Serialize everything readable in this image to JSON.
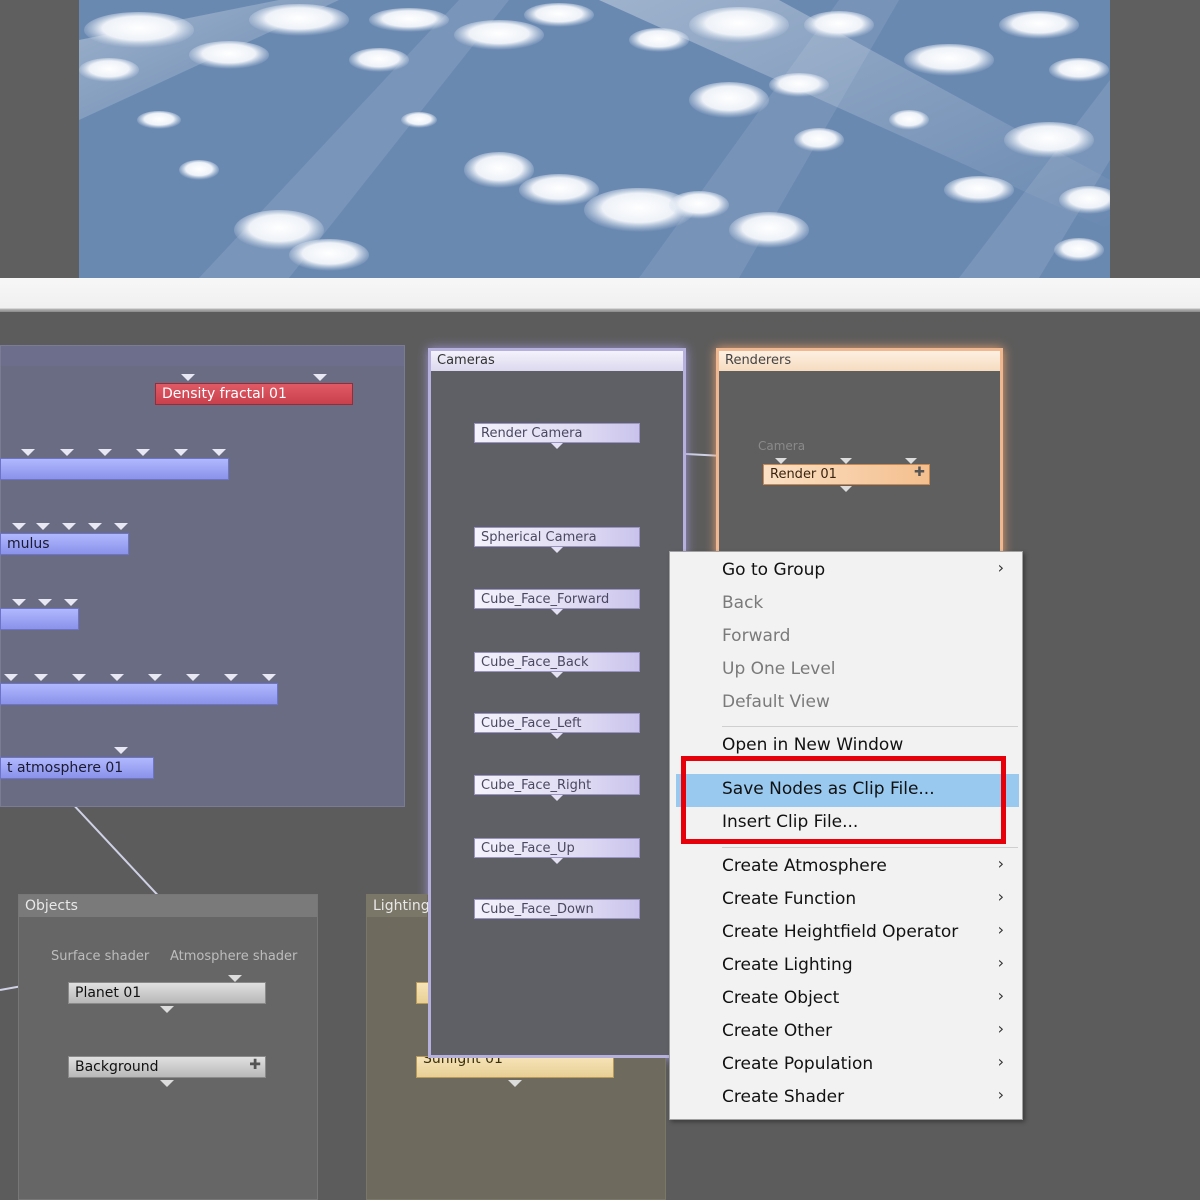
{
  "colors": {
    "menu_highlight": "#99c9ef",
    "annotation_outline": "#e6000a",
    "node_blue": "#9aa2f5",
    "node_red": "#d04c58"
  },
  "groups": {
    "cameras": "Cameras",
    "renderers": "Renderers",
    "objects": "Objects",
    "lighting": "Lighting"
  },
  "nodes": {
    "density_fractal": "Density fractal 01",
    "cumulus": "mulus",
    "atmosphere": "t atmosphere 01",
    "render_camera": "Render Camera",
    "spherical_camera": "Spherical Camera",
    "cube_forward": "Cube_Face_Forward",
    "cube_back": "Cube_Face_Back",
    "cube_left": "Cube_Face_Left",
    "cube_right": "Cube_Face_Right",
    "cube_up": "Cube_Face_Up",
    "cube_down": "Cube_Face_Down",
    "render01": "Render 01",
    "planet01": "Planet 01",
    "background": "Background",
    "sunlight": "Sunlight 01"
  },
  "port_labels": {
    "camera": "Camera",
    "surface_shader": "Surface shader",
    "atmosphere_shader": "Atmosphere shader"
  },
  "menu": {
    "items": [
      {
        "label": "Go to Group",
        "arrow": "›",
        "disabled": false
      },
      {
        "label": "Back",
        "disabled": true
      },
      {
        "label": "Forward",
        "disabled": true
      },
      {
        "label": "Up One Level",
        "disabled": true
      },
      {
        "label": "Default View",
        "disabled": true
      },
      {
        "label": "Open in New Window",
        "disabled": false
      },
      {
        "label": "Save Nodes as Clip File...",
        "disabled": false,
        "highlighted": true
      },
      {
        "label": "Insert Clip File...",
        "disabled": false
      },
      {
        "label": "Create Atmosphere",
        "arrow": "›"
      },
      {
        "label": "Create Function",
        "arrow": "›"
      },
      {
        "label": "Create Heightfield Operator",
        "arrow": "›"
      },
      {
        "label": "Create Lighting",
        "arrow": "›"
      },
      {
        "label": "Create Object",
        "arrow": "›"
      },
      {
        "label": "Create Other",
        "arrow": "›"
      },
      {
        "label": "Create Population",
        "arrow": "›"
      },
      {
        "label": "Create Shader",
        "arrow": "›"
      }
    ]
  }
}
